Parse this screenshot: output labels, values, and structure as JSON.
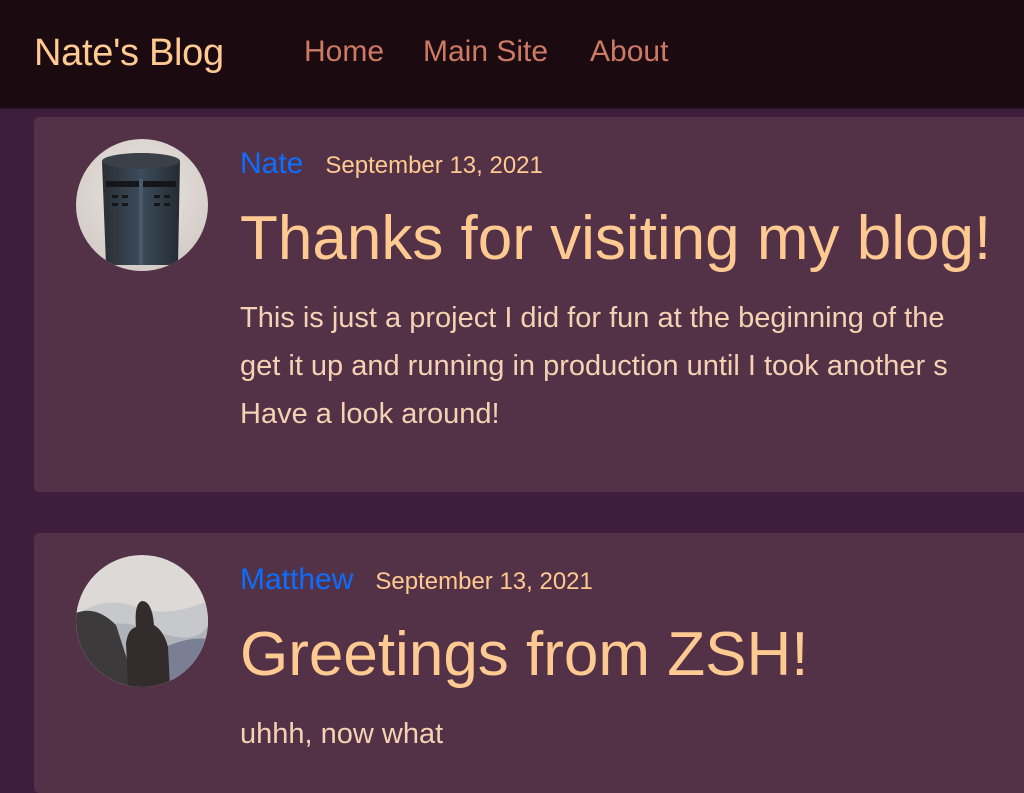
{
  "navbar": {
    "brand": "Nate's Blog",
    "links": [
      {
        "label": "Home"
      },
      {
        "label": "Main Site"
      },
      {
        "label": "About"
      }
    ]
  },
  "posts": [
    {
      "author": "Nate",
      "date": "September 13, 2021",
      "title": "Thanks for visiting my blog!",
      "content": "This is just a project I did for fun at the beginning of the\nget it up and running in production until I took another s\nHave a look around!",
      "avatar_icon": "knight-helmet-avatar"
    },
    {
      "author": "Matthew",
      "date": "September 13, 2021",
      "title": "Greetings from ZSH!",
      "content": "uhhh, now what",
      "avatar_icon": "hooded-figure-mountains-avatar"
    }
  ],
  "colors": {
    "navbar_bg": "#1c0a11",
    "page_bg": "#3d1f3d",
    "card_bg": "#533146",
    "brand": "#ffca91",
    "nav_link": "#cb7a63",
    "author_link": "#0d6efd",
    "text": "#ffca91"
  }
}
